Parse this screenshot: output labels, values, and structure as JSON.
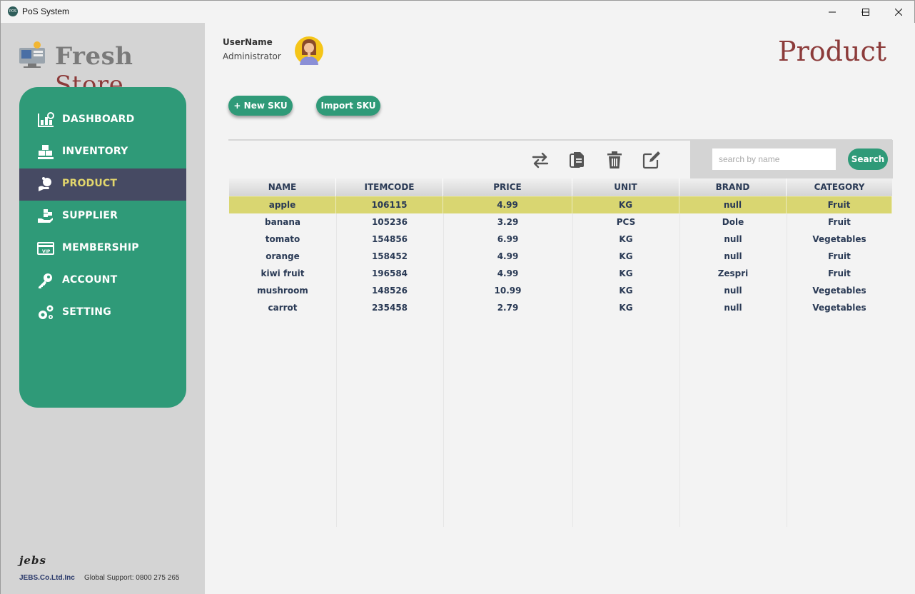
{
  "window": {
    "title": "PoS System",
    "icon_text": "POS"
  },
  "sidebar": {
    "brand_part1": "Fresh",
    "brand_part2": "Store",
    "items": [
      {
        "label": "DASHBOARD",
        "icon": "dashboard-icon"
      },
      {
        "label": "INVENTORY",
        "icon": "boxes-icon"
      },
      {
        "label": "PRODUCT",
        "icon": "product-hand-icon",
        "active": true
      },
      {
        "label": "SUPPLIER",
        "icon": "supplier-icon"
      },
      {
        "label": "MEMBERSHIP",
        "icon": "vip-card-icon"
      },
      {
        "label": "ACCOUNT",
        "icon": "key-icon"
      },
      {
        "label": "SETTING",
        "icon": "gears-icon"
      }
    ],
    "footer_logo": "jebs",
    "footer_company": "JEBS.Co.Ltd.Inc",
    "footer_support": "Global Support: 0800 275 265"
  },
  "header": {
    "user_label": "UserName",
    "user_role": "Administrator",
    "page_title": "Product"
  },
  "actions": {
    "new_sku": "+ New SKU",
    "import_sku": "Import SKU"
  },
  "toolbar": {
    "icons": [
      "transfer-icon",
      "copy-icon",
      "delete-icon",
      "edit-icon"
    ]
  },
  "search": {
    "placeholder": "search by name",
    "button": "Search"
  },
  "table": {
    "columns": [
      "NAME",
      "ITEMCODE",
      "PRICE",
      "UNIT",
      "BRAND",
      "CATEGORY"
    ],
    "rows": [
      [
        "apple",
        "106115",
        "4.99",
        "KG",
        "null",
        "Fruit"
      ],
      [
        "banana",
        "105236",
        "3.29",
        "PCS",
        "Dole",
        "Fruit"
      ],
      [
        "tomato",
        "154856",
        "6.99",
        "KG",
        "null",
        "Vegetables"
      ],
      [
        "orange",
        "158452",
        "4.99",
        "KG",
        "null",
        "Fruit"
      ],
      [
        "kiwi fruit",
        "196584",
        "4.99",
        "KG",
        "Zespri",
        "Fruit"
      ],
      [
        "mushroom",
        "148526",
        "10.99",
        "KG",
        "null",
        "Vegetables"
      ],
      [
        "carrot",
        "235458",
        "2.79",
        "KG",
        "null",
        "Vegetables"
      ]
    ],
    "selected_row": 0
  },
  "colors": {
    "accent_green": "#2f9a78",
    "nav_active_bg": "#464a63",
    "nav_active_text": "#e2d66c",
    "title_red": "#8c3b3a",
    "selected_row": "#d9d671"
  }
}
